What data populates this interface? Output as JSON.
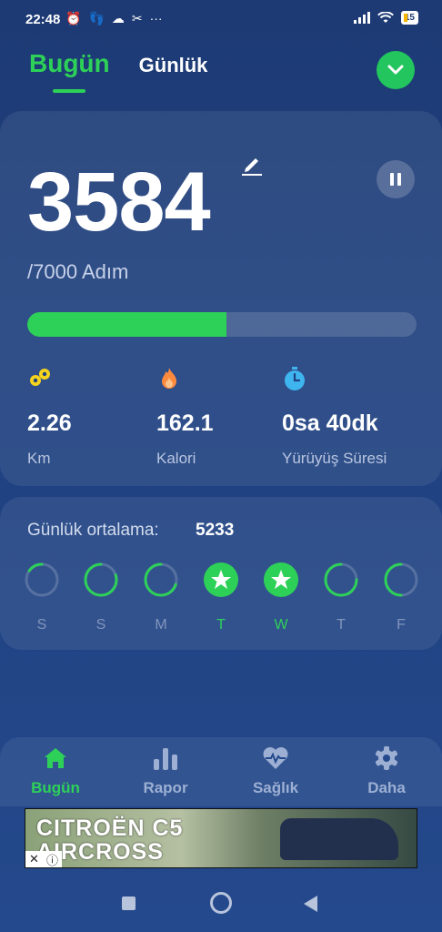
{
  "status_bar": {
    "time": "22:48",
    "battery": "15"
  },
  "header": {
    "tab_today": "Bugün",
    "tab_daily": "Günlük"
  },
  "today": {
    "steps": "3584",
    "goal_text": "/7000 Adım",
    "progress_fraction": 0.512,
    "stats": [
      {
        "icon": "distance-icon",
        "value": "2.26",
        "label": "Km",
        "color": "#f6d31c"
      },
      {
        "icon": "flame-icon",
        "value": "162.1",
        "label": "Kalori",
        "color": "#ff8a3d"
      },
      {
        "icon": "stopwatch-icon",
        "value": "0sa 40dk",
        "label": "Yürüyüş Süresi",
        "color": "#3fb5f0"
      }
    ]
  },
  "weekly": {
    "avg_label": "Günlük ortalama:",
    "avg_value": "5233",
    "days": [
      {
        "letter": "S",
        "progress": 0.15,
        "done": false
      },
      {
        "letter": "S",
        "progress": 0.8,
        "done": false
      },
      {
        "letter": "M",
        "progress": 0.7,
        "done": false
      },
      {
        "letter": "T",
        "progress": 1.0,
        "done": true
      },
      {
        "letter": "W",
        "progress": 1.0,
        "done": true
      },
      {
        "letter": "T",
        "progress": 0.75,
        "done": false
      },
      {
        "letter": "F",
        "progress": 0.5,
        "done": false
      }
    ]
  },
  "bottom_nav": [
    {
      "label": "Bugün",
      "icon": "home-icon",
      "active": true
    },
    {
      "label": "Rapor",
      "icon": "bar-chart-icon",
      "active": false
    },
    {
      "label": "Sağlık",
      "icon": "heart-pulse-icon",
      "active": false
    },
    {
      "label": "Daha",
      "icon": "gear-icon",
      "active": false
    }
  ],
  "ad": {
    "text_line1": "CITROËN C5",
    "text_line2": "AIRCROSS"
  },
  "colors": {
    "accent": "#2ed158",
    "background": "#1f4180"
  }
}
